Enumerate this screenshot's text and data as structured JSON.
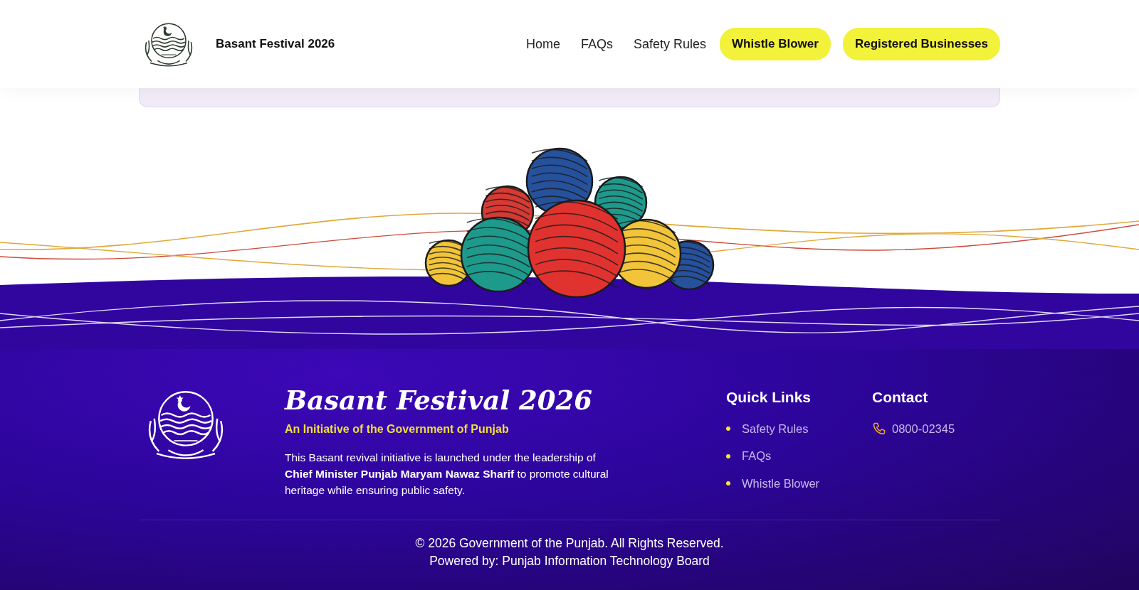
{
  "header": {
    "title": "Basant Festival 2026",
    "nav": [
      {
        "label": "Home",
        "kind": "link"
      },
      {
        "label": "FAQs",
        "kind": "link"
      },
      {
        "label": "Safety Rules",
        "kind": "link"
      },
      {
        "label": "Whistle Blower",
        "kind": "pill"
      },
      {
        "label": "Registered Businesses",
        "kind": "pill"
      }
    ]
  },
  "footer": {
    "title": "Basant Festival 2026",
    "subtitle": "An Initiative of the Government of Punjab",
    "description": "This Basant revival initiative is launched under the leadership of **Chief Minister Punjab Maryam Nawaz Sharif** to promote cultural heritage while ensuring public safety.",
    "quick_links": {
      "heading": "Quick Links",
      "items": [
        "Safety Rules",
        "FAQs",
        "Whistle Blower"
      ]
    },
    "contact": {
      "heading": "Contact",
      "phone": "0800-02345"
    },
    "copyright": "© 2026 Government of the Punjab. All Rights Reserved.",
    "powered_by": "Powered by: Punjab Information Technology Board"
  }
}
